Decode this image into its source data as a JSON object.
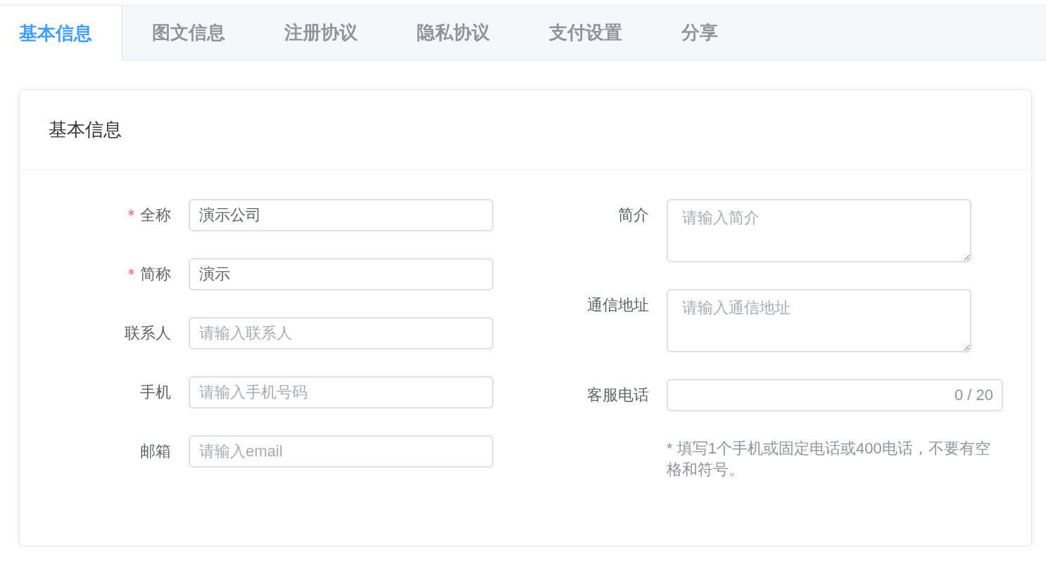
{
  "tabs": [
    {
      "label": "基本信息",
      "selected": true
    },
    {
      "label": "图文信息",
      "selected": false
    },
    {
      "label": "注册协议",
      "selected": false
    },
    {
      "label": "隐私协议",
      "selected": false
    },
    {
      "label": "支付设置",
      "selected": false
    },
    {
      "label": "分享",
      "selected": false
    }
  ],
  "card": {
    "title": "基本信息",
    "left_fields": [
      {
        "kind": "input",
        "label": "全称",
        "required": true,
        "value": "演示公司"
      },
      {
        "kind": "input",
        "label": "简称",
        "required": true,
        "value": "演示"
      },
      {
        "kind": "input",
        "label": "联系人",
        "required": false,
        "placeholder": "请输入联系人"
      },
      {
        "kind": "input",
        "label": "手机",
        "required": false,
        "placeholder": "请输入手机号码"
      },
      {
        "kind": "input",
        "label": "邮箱",
        "required": false,
        "placeholder": "请输入email"
      }
    ],
    "right_fields": [
      {
        "kind": "textarea",
        "label": "简介",
        "required": false,
        "placeholder": "请输入简介"
      },
      {
        "kind": "textarea",
        "label": "通信地址",
        "required": false,
        "placeholder": "请输入通信地址"
      },
      {
        "kind": "counter",
        "label": "客服电话",
        "required": false,
        "counter": "0 / 20",
        "hint": "* 填写1个手机或固定电话或400电话，不要有空格和符号。"
      }
    ]
  }
}
